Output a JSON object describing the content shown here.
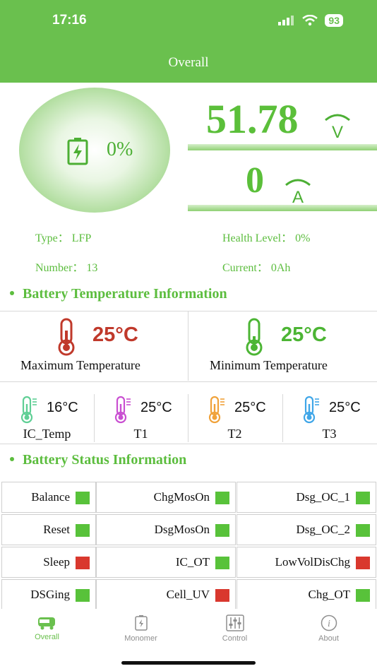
{
  "status_bar": {
    "time": "17:16",
    "battery": "93"
  },
  "header": {
    "title": "Overall"
  },
  "soc": {
    "value": "0%"
  },
  "voltage": {
    "value": "51.78",
    "unit": "V"
  },
  "current": {
    "value": "0",
    "unit": "A"
  },
  "info": {
    "type": "Type：  LFP",
    "health": "Health Level：  0%",
    "number": "Number：  13",
    "capacity": "Current：  0Ah"
  },
  "temperature_section": {
    "title": "Battery Temperature Information",
    "max_value": "25°C",
    "max_label": "Maximum Temperature",
    "min_value": "25°C",
    "min_label": "Minimum Temperature",
    "sensors": [
      {
        "label": "IC_Temp",
        "value": "16°C",
        "color": "#5fcf95"
      },
      {
        "label": "T1",
        "value": "25°C",
        "color": "#c94fd1"
      },
      {
        "label": "T2",
        "value": "25°C",
        "color": "#f0a23a"
      },
      {
        "label": "T3",
        "value": "25°C",
        "color": "#3fa6e8"
      }
    ]
  },
  "status_section": {
    "title": "Battery Status Information",
    "items": [
      {
        "label": "Balance",
        "state": "green"
      },
      {
        "label": "ChgMosOn",
        "state": "green"
      },
      {
        "label": "Dsg_OC_1",
        "state": "green"
      },
      {
        "label": "Reset",
        "state": "green"
      },
      {
        "label": "DsgMosOn",
        "state": "green"
      },
      {
        "label": "Dsg_OC_2",
        "state": "green"
      },
      {
        "label": "Sleep",
        "state": "red"
      },
      {
        "label": "IC_OT",
        "state": "green"
      },
      {
        "label": "LowVolDisChg",
        "state": "red"
      },
      {
        "label": "DSGing",
        "state": "green"
      },
      {
        "label": "Cell_UV",
        "state": "red"
      },
      {
        "label": "Chg_OT",
        "state": "green"
      }
    ]
  },
  "colors": {
    "accent": "#6ac04e",
    "ok": "#58c23a",
    "alarm": "#d9382e",
    "max_temp": "#c0392b",
    "min_temp": "#4cb534"
  },
  "tabs": [
    {
      "label": "Overall",
      "icon": "battery-car-icon",
      "active": true
    },
    {
      "label": "Monomer",
      "icon": "battery-cell-icon",
      "active": false
    },
    {
      "label": "Control",
      "icon": "sliders-icon",
      "active": false
    },
    {
      "label": "About",
      "icon": "info-icon",
      "active": false
    }
  ]
}
